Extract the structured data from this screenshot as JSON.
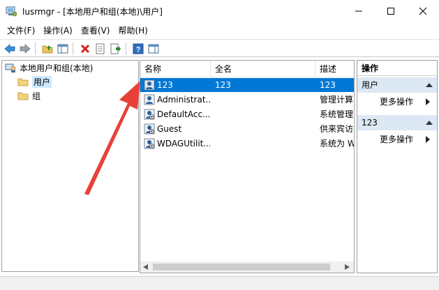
{
  "window": {
    "title": "lusrmgr - [本地用户和组(本地)\\用户]"
  },
  "menu": [
    {
      "label": "文件(F)"
    },
    {
      "label": "操作(A)"
    },
    {
      "label": "查看(V)"
    },
    {
      "label": "帮助(H)"
    }
  ],
  "tree": {
    "root": "本地用户和组(本地)",
    "items": [
      {
        "label": "用户",
        "selected": true
      },
      {
        "label": "组",
        "selected": false
      }
    ]
  },
  "list": {
    "columns": [
      "名称",
      "全名",
      "描述"
    ],
    "rows": [
      {
        "name": "123",
        "fullname": "123",
        "desc": "123",
        "selected": true
      },
      {
        "name": "Administrat...",
        "fullname": "",
        "desc": "管理计算"
      },
      {
        "name": "DefaultAcc...",
        "fullname": "",
        "desc": "系统管理"
      },
      {
        "name": "Guest",
        "fullname": "",
        "desc": "供来宾访"
      },
      {
        "name": "WDAGUtilit...",
        "fullname": "",
        "desc": "系统为 W"
      }
    ]
  },
  "actions": {
    "title": "操作",
    "sections": [
      {
        "label": "用户",
        "item": "更多操作"
      },
      {
        "label": "123",
        "item": "更多操作"
      }
    ]
  },
  "colors": {
    "selection": "#0078d7",
    "tree_selection": "#cce8ff",
    "action_section": "#dce9f5",
    "arrow": "#e8413a"
  },
  "icons": {
    "app": "computer-management-icon",
    "user": "user-icon",
    "folder": "folder-icon"
  }
}
